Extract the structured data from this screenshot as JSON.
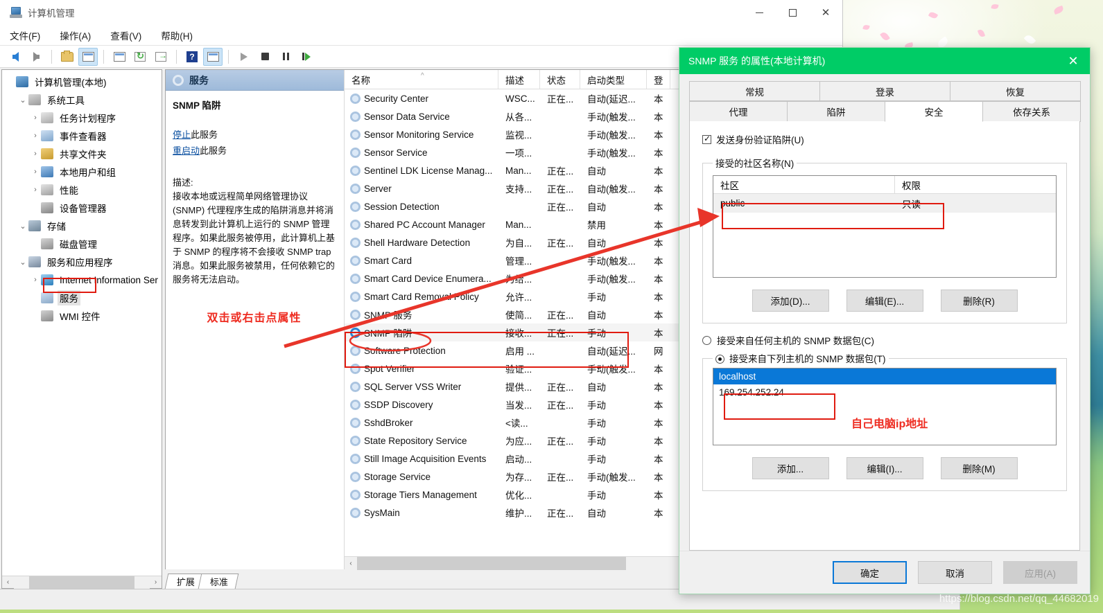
{
  "window": {
    "title": "计算机管理",
    "icon": "computer-management-icon",
    "controls": {
      "minimize": "—",
      "maximize": "□",
      "close": "✕"
    }
  },
  "menubar": [
    "文件(F)",
    "操作(A)",
    "查看(V)",
    "帮助(H)"
  ],
  "toolbar": {
    "icons": [
      "back-arrow-icon",
      "forward-arrow-icon",
      "up-folder-icon",
      "show-hide-tree-icon",
      "properties-icon",
      "refresh-icon",
      "export-list-icon",
      "help-icon",
      "show-action-pane-icon",
      "start-service-icon",
      "stop-service-icon",
      "pause-service-icon",
      "restart-service-icon"
    ]
  },
  "tree": [
    {
      "label": "计算机管理(本地)",
      "indent": 0,
      "expander": "",
      "icon": "computer-icon",
      "selected": false
    },
    {
      "label": "系统工具",
      "indent": 1,
      "expander": "⌄",
      "icon": "tools-icon",
      "selected": false
    },
    {
      "label": "任务计划程序",
      "indent": 2,
      "expander": "›",
      "icon": "clock-icon",
      "selected": false
    },
    {
      "label": "事件查看器",
      "indent": 2,
      "expander": "›",
      "icon": "event-viewer-icon",
      "selected": false
    },
    {
      "label": "共享文件夹",
      "indent": 2,
      "expander": "›",
      "icon": "shared-folders-icon",
      "selected": false
    },
    {
      "label": "本地用户和组",
      "indent": 2,
      "expander": "›",
      "icon": "users-icon",
      "selected": false
    },
    {
      "label": "性能",
      "indent": 2,
      "expander": "›",
      "icon": "performance-icon",
      "selected": false
    },
    {
      "label": "设备管理器",
      "indent": 2,
      "expander": "",
      "icon": "device-manager-icon",
      "selected": false
    },
    {
      "label": "存储",
      "indent": 1,
      "expander": "⌄",
      "icon": "storage-icon",
      "selected": false
    },
    {
      "label": "磁盘管理",
      "indent": 2,
      "expander": "",
      "icon": "disk-management-icon",
      "selected": false
    },
    {
      "label": "服务和应用程序",
      "indent": 1,
      "expander": "⌄",
      "icon": "services-apps-icon",
      "selected": false
    },
    {
      "label": "Internet Information Ser",
      "indent": 2,
      "expander": "›",
      "icon": "iis-icon",
      "selected": false
    },
    {
      "label": "服务",
      "indent": 2,
      "expander": "",
      "icon": "services-icon",
      "selected": true
    },
    {
      "label": "WMI 控件",
      "indent": 2,
      "expander": "",
      "icon": "wmi-icon",
      "selected": false
    }
  ],
  "details": {
    "header": "服务",
    "header_icon": "services-gear-icon",
    "service_name": "SNMP 陷阱",
    "links": [
      {
        "link": "停止",
        "suffix": "此服务"
      },
      {
        "link": "重启动",
        "suffix": "此服务"
      }
    ],
    "description_label": "描述:",
    "description": "接收本地或远程简单网络管理协议 (SNMP) 代理程序生成的陷阱消息并将消息转发到此计算机上运行的 SNMP 管理程序。如果此服务被停用，此计算机上基于 SNMP 的程序将不会接收 SNMP trap 消息。如果此服务被禁用，任何依赖它的服务将无法启动。",
    "annotation": "双击或右击点属性"
  },
  "services_table": {
    "columns": [
      "名称",
      "描述",
      "状态",
      "启动类型",
      "登"
    ],
    "sort_indicator": "^",
    "rows": [
      {
        "name": "Security Center",
        "desc": "WSC...",
        "state": "正在...",
        "startup": "自动(延迟...",
        "logon": "本"
      },
      {
        "name": "Sensor Data Service",
        "desc": "从各...",
        "state": "",
        "startup": "手动(触发...",
        "logon": "本"
      },
      {
        "name": "Sensor Monitoring Service",
        "desc": "监视...",
        "state": "",
        "startup": "手动(触发...",
        "logon": "本"
      },
      {
        "name": "Sensor Service",
        "desc": "一项...",
        "state": "",
        "startup": "手动(触发...",
        "logon": "本"
      },
      {
        "name": "Sentinel LDK License Manag...",
        "desc": "Man...",
        "state": "正在...",
        "startup": "自动",
        "logon": "本"
      },
      {
        "name": "Server",
        "desc": "支持...",
        "state": "正在...",
        "startup": "自动(触发...",
        "logon": "本"
      },
      {
        "name": "Session Detection",
        "desc": "",
        "state": "正在...",
        "startup": "自动",
        "logon": "本"
      },
      {
        "name": "Shared PC Account Manager",
        "desc": "Man...",
        "state": "",
        "startup": "禁用",
        "logon": "本"
      },
      {
        "name": "Shell Hardware Detection",
        "desc": "为自...",
        "state": "正在...",
        "startup": "自动",
        "logon": "本"
      },
      {
        "name": "Smart Card",
        "desc": "管理...",
        "state": "",
        "startup": "手动(触发...",
        "logon": "本"
      },
      {
        "name": "Smart Card Device Enumera...",
        "desc": "为给...",
        "state": "",
        "startup": "手动(触发...",
        "logon": "本"
      },
      {
        "name": "Smart Card Removal Policy",
        "desc": "允许...",
        "state": "",
        "startup": "手动",
        "logon": "本"
      },
      {
        "name": "SNMP 服务",
        "desc": "使简...",
        "state": "正在...",
        "startup": "自动",
        "logon": "本"
      },
      {
        "name": "SNMP 陷阱",
        "desc": "接收...",
        "state": "正在...",
        "startup": "手动",
        "logon": "本"
      },
      {
        "name": "Software Protection",
        "desc": "启用 ...",
        "state": "",
        "startup": "自动(延迟...",
        "logon": "网"
      },
      {
        "name": "Spot Verifier",
        "desc": "验证...",
        "state": "",
        "startup": "手动(触发...",
        "logon": "本"
      },
      {
        "name": "SQL Server VSS Writer",
        "desc": "提供...",
        "state": "正在...",
        "startup": "自动",
        "logon": "本"
      },
      {
        "name": "SSDP Discovery",
        "desc": "当发...",
        "state": "正在...",
        "startup": "手动",
        "logon": "本"
      },
      {
        "name": "SshdBroker",
        "desc": "<读...",
        "state": "",
        "startup": "手动",
        "logon": "本"
      },
      {
        "name": "State Repository Service",
        "desc": "为应...",
        "state": "正在...",
        "startup": "手动",
        "logon": "本"
      },
      {
        "name": "Still Image Acquisition Events",
        "desc": "启动...",
        "state": "",
        "startup": "手动",
        "logon": "本"
      },
      {
        "name": "Storage Service",
        "desc": "为存...",
        "state": "正在...",
        "startup": "手动(触发...",
        "logon": "本"
      },
      {
        "name": "Storage Tiers Management",
        "desc": "优化...",
        "state": "",
        "startup": "手动",
        "logon": "本"
      },
      {
        "name": "SysMain",
        "desc": "维护...",
        "state": "正在...",
        "startup": "自动",
        "logon": "本"
      }
    ]
  },
  "mmc_tabs": [
    "扩展",
    "标准"
  ],
  "dialog": {
    "title": "SNMP 服务 的属性(本地计算机)",
    "close_icon": "close-icon",
    "tabs_row1": [
      "常规",
      "登录",
      "恢复"
    ],
    "tabs_row2": [
      "代理",
      "陷阱",
      "安全",
      "依存关系"
    ],
    "active_tab": "安全",
    "checkbox": {
      "label": "发送身份验证陷阱(U)",
      "checked": true
    },
    "community_group": {
      "legend": "接受的社区名称(N)",
      "columns": [
        "社区",
        "权限"
      ],
      "rows": [
        {
          "community": "public",
          "rights": "只读"
        }
      ],
      "buttons": [
        "添加(D)...",
        "编辑(E)...",
        "删除(R)"
      ]
    },
    "radio_any": {
      "label": "接受来自任何主机的 SNMP 数据包(C)",
      "selected": false
    },
    "radio_list": {
      "label": "接受来自下列主机的 SNMP 数据包(T)",
      "selected": true
    },
    "hosts": [
      {
        "value": "localhost",
        "selected": true
      },
      {
        "value": "169.254.252.24",
        "selected": false
      }
    ],
    "host_buttons": [
      "添加...",
      "编辑(I)...",
      "删除(M)"
    ],
    "footer_buttons": [
      {
        "label": "确定",
        "style": "primary"
      },
      {
        "label": "取消",
        "style": "normal"
      },
      {
        "label": "应用(A)",
        "style": "disabled"
      }
    ],
    "annotation": "自己电脑ip地址"
  },
  "scrollbars": {
    "up_arrow": "⌃",
    "down_arrow": "⌄",
    "left_arrow": "‹",
    "right_arrow": "›"
  },
  "watermark": "https://blog.csdn.net/qq_44682019",
  "colors": {
    "dialog_title_bg": "#00cc66",
    "annotation_red": "#ee2b20",
    "selection_blue": "#0a78d7",
    "details_header": "#9ebada"
  }
}
